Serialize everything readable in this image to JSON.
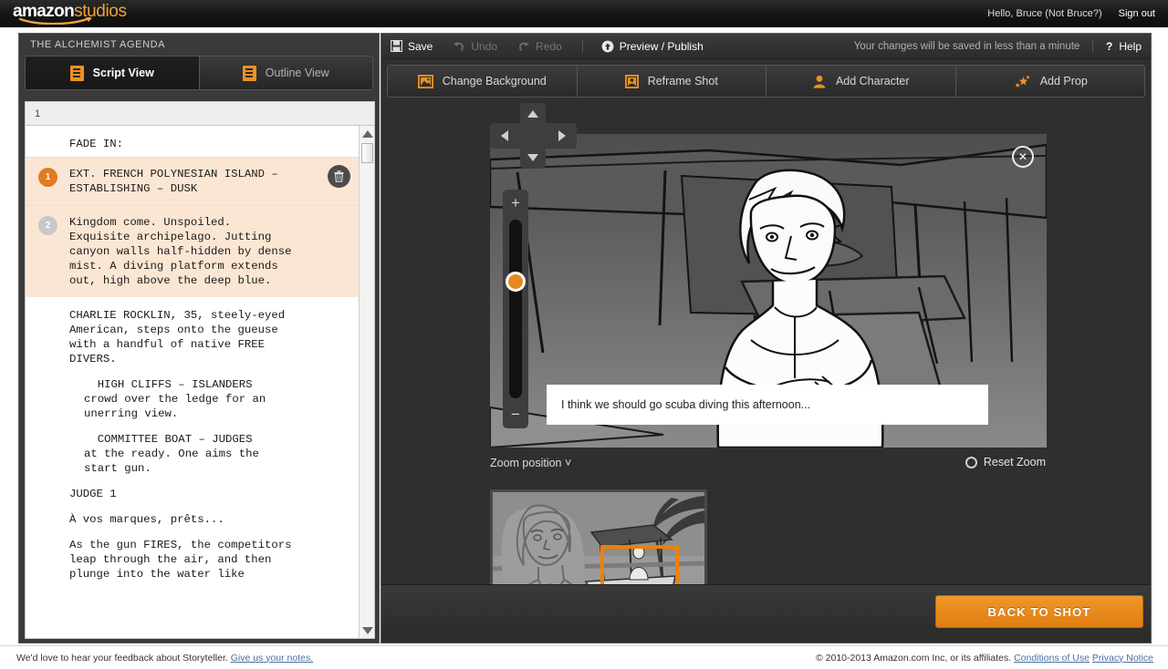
{
  "brand": {
    "name_bold": "amazon",
    "name_light": "studios"
  },
  "account": {
    "greeting": "Hello, Bruce (Not Bruce?)",
    "signout": "Sign out"
  },
  "left_panel": {
    "title": "THE ALCHEMIST AGENDA",
    "tabs": [
      {
        "label": "Script View",
        "active": true
      },
      {
        "label": "Outline View",
        "active": false
      }
    ],
    "page_number": "1",
    "script": {
      "fade_in": "FADE IN:",
      "scenes": [
        {
          "num": "1",
          "text": "EXT. FRENCH POLYNESIAN ISLAND –\nESTABLISHING – DUSK",
          "badge_color": "#e07b22"
        },
        {
          "num": "2",
          "text": "Kingdom come. Unspoiled.\nExquisite archipelago. Jutting\ncanyon walls half-hidden by dense\nmist. A diving platform extends\nout, high above the deep blue.",
          "badge_color": "#c8c8c8"
        }
      ],
      "body": [
        "CHARLIE ROCKLIN, 35, steely-eyed\nAmerican, steps onto the gueuse\nwith a handful of native FREE\nDIVERS.",
        "  HIGH CLIFFS – ISLANDERS\ncrowd over the ledge for an\nunerring view.",
        "  COMMITTEE BOAT – JUDGES\nat the ready. One aims the\nstart gun.",
        "JUDGE 1",
        "À vos marques, prêts...",
        "As the gun FIRES, the competitors\nleap through the air, and then\nplunge into the water like"
      ]
    }
  },
  "toolbar": {
    "save": "Save",
    "undo": "Undo",
    "redo": "Redo",
    "preview_publish": "Preview / Publish",
    "save_status": "Your changes will be saved in less than a minute",
    "help": "Help",
    "actions": [
      {
        "label": "Change Background",
        "icon": "image-icon"
      },
      {
        "label": "Reframe Shot",
        "icon": "portrait-frame-icon"
      },
      {
        "label": "Add Character",
        "icon": "person-icon"
      },
      {
        "label": "Add Prop",
        "icon": "sparkle-stars-icon"
      }
    ]
  },
  "stage": {
    "caption_text": "I think we should go scuba diving this afternoon...",
    "zoom_position_label": "Zoom position",
    "reset_zoom_label": "Reset Zoom",
    "zoom_in_symbol": "+",
    "zoom_out_symbol": "−",
    "close_symbol": "✕",
    "selection_color": "#f08000"
  },
  "bottom": {
    "back_to_shot": "BACK TO SHOT"
  },
  "footer": {
    "feedback_text": "We'd love to hear your feedback about Storyteller.",
    "feedback_link": "Give us your notes.",
    "copyright": "© 2010-2013 Amazon.com Inc, or its affiliates.",
    "conditions_link": "Conditions of Use",
    "privacy_link": "Privacy Notice"
  }
}
